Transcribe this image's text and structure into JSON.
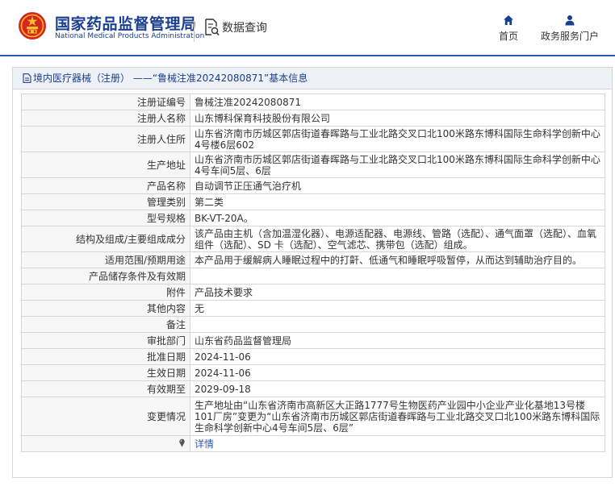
{
  "header": {
    "site_name_cn": "国家药品监督管理局",
    "site_name_en": "National Medical Products Administration",
    "section_title": "数据查询",
    "nav_home": "首页",
    "nav_gov_service": "政务服务门户",
    "colors": {
      "brand": "#1a3f8f",
      "accent": "#2e5bb0",
      "emblem_red": "#d7261e",
      "emblem_gold": "#f2c12e"
    }
  },
  "panel": {
    "title": "境内医疗器械（注册） ——“鲁械注准20242080871”基本信息"
  },
  "rows": [
    {
      "label": "注册证编号",
      "value": "鲁械注准20242080871"
    },
    {
      "label": "注册人名称",
      "value": "山东博科保育科技股份有限公司"
    },
    {
      "label": "注册人住所",
      "value": "山东省济南市历城区郭店街道春晖路与工业北路交叉口北100米路东博科国际生命科学创新中心4号楼6层602"
    },
    {
      "label": "生产地址",
      "value": "山东省济南市历城区郭店街道春晖路与工业北路交叉口北100米路东博科国际生命科学创新中心4号车间5层、6层"
    },
    {
      "label": "产品名称",
      "value": "自动调节正压通气治疗机"
    },
    {
      "label": "管理类别",
      "value": "第二类"
    },
    {
      "label": "型号规格",
      "value": "BK-VT-20A。"
    },
    {
      "label": "结构及组成/主要组成成分",
      "value": "该产品由主机（含加温湿化器）、电源适配器、电源线、管路（选配）、通气面罩（选配）、血氧组件（选配）、SD 卡（选配）、空气滤芯、携带包（选配）组成。"
    },
    {
      "label": "适用范围/预期用途",
      "value": "本产品用于缓解病人睡眠过程中的打鼾、低通气和睡眠呼吸暂停，从而达到辅助治疗目的。"
    },
    {
      "label": "产品储存条件及有效期",
      "value": ""
    },
    {
      "label": "附件",
      "value": "产品技术要求"
    },
    {
      "label": "其他内容",
      "value": "无"
    },
    {
      "label": "备注",
      "value": ""
    },
    {
      "label": "审批部门",
      "value": "山东省药品监督管理局"
    },
    {
      "label": "批准日期",
      "value": "2024-11-06"
    },
    {
      "label": "生效日期",
      "value": "2024-11-06"
    },
    {
      "label": "有效期至",
      "value": "2029-09-18"
    },
    {
      "label": "变更情况",
      "value": "生产地址由“山东省济南市高新区大正路1777号生物医药产业园中小企业产业化基地13号楼101厂房”变更为“山东省济南市历城区郭店街道春晖路与工业北路交叉口北100米路东博科国际生命科学创新中心4号车间5层、6层”"
    }
  ],
  "footer_row": {
    "label_icon": "pin-icon",
    "link_text": "详情"
  }
}
